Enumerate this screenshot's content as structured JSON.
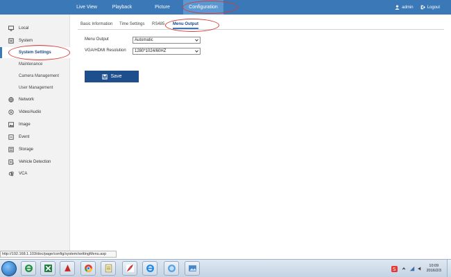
{
  "topnav": {
    "items": [
      "Live View",
      "Playback",
      "Picture",
      "Configuration"
    ],
    "user": "admin",
    "logout": "Logout"
  },
  "sidebar": {
    "items": [
      {
        "label": "Local",
        "icon": "monitor-icon"
      },
      {
        "label": "System",
        "icon": "system-icon"
      },
      {
        "label": "System Settings"
      },
      {
        "label": "Maintenance"
      },
      {
        "label": "Camera Management"
      },
      {
        "label": "User Management"
      },
      {
        "label": "Network",
        "icon": "globe-icon"
      },
      {
        "label": "Video/Audio",
        "icon": "video-icon"
      },
      {
        "label": "Image",
        "icon": "image-icon"
      },
      {
        "label": "Event",
        "icon": "event-icon"
      },
      {
        "label": "Storage",
        "icon": "storage-icon"
      },
      {
        "label": "Vehicle Detection",
        "icon": "vehicle-detection-icon"
      },
      {
        "label": "VCA",
        "icon": "vca-icon"
      }
    ]
  },
  "tabs": [
    "Basic Information",
    "Time Settings",
    "RS485",
    "Menu Output"
  ],
  "form": {
    "menu_output_label": "Menu Output",
    "menu_output_value": "Automatic",
    "vga_label": "VGA/HDMI Resolution",
    "vga_value": "1280*1024/60HZ",
    "save_label": "Save"
  },
  "status_url": "http://192.168.1.103/doc/page/config/system/settingMenu.asp",
  "taskbar": {
    "time": "10:09",
    "date": "2016/2/3"
  },
  "colors": {
    "nav_bg": "#3a78b8",
    "save_bg": "#1e4e8c",
    "annotation": "#d63a3a"
  }
}
